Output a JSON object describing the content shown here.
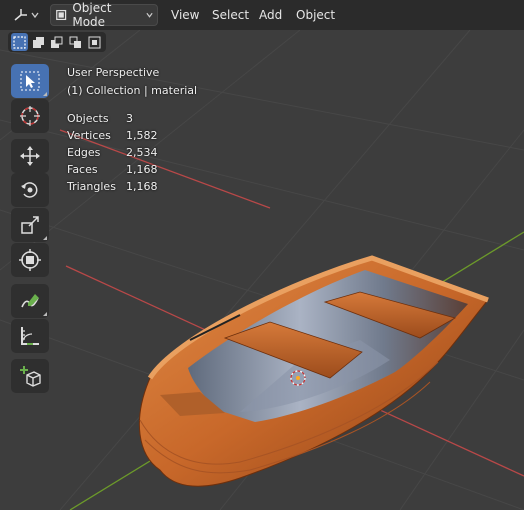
{
  "header": {
    "mode_label": "Object Mode",
    "menus": [
      "View",
      "Select",
      "Add",
      "Object"
    ]
  },
  "overlay": {
    "view_name": "User Perspective",
    "collection": "(1) Collection | material",
    "stats": [
      {
        "label": "Objects",
        "value": "3"
      },
      {
        "label": "Vertices",
        "value": "1,582"
      },
      {
        "label": "Edges",
        "value": "2,534"
      },
      {
        "label": "Faces",
        "value": "1,168"
      },
      {
        "label": "Triangles",
        "value": "1,168"
      }
    ]
  },
  "toolbar": {
    "tools": [
      "select-box-icon",
      "cursor-icon",
      "move-icon",
      "rotate-icon",
      "scale-icon",
      "transform-icon",
      "annotate-icon",
      "measure-icon",
      "add-cube-icon"
    ],
    "active_tool": "select-box-icon"
  },
  "colors": {
    "accent": "#4772b3",
    "header_bg": "#2b2b2b",
    "viewport_bg": "#3d3d3d",
    "x_axis": "#b84848",
    "y_axis": "#6c9a2a",
    "boat_wood": "#c8682a"
  }
}
